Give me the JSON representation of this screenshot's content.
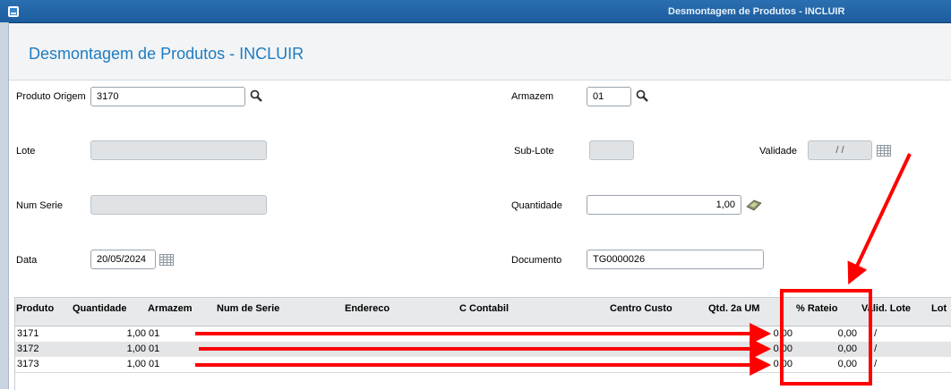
{
  "window": {
    "title": "Desmontagem de Produtos - INCLUIR"
  },
  "page": {
    "title": "Desmontagem de Produtos - INCLUIR"
  },
  "form": {
    "produto_origem": {
      "label": "Produto Origem",
      "value": "3170"
    },
    "armazem": {
      "label": "Armazem",
      "value": "01"
    },
    "lote": {
      "label": "Lote",
      "value": ""
    },
    "sub_lote": {
      "label": "Sub-Lote",
      "value": ""
    },
    "validade": {
      "label": "Validade",
      "value": "  /  /"
    },
    "num_serie": {
      "label": "Num Serie",
      "value": ""
    },
    "quantidade": {
      "label": "Quantidade",
      "value": "1,00"
    },
    "data": {
      "label": "Data",
      "value": "20/05/2024"
    },
    "documento": {
      "label": "Documento",
      "value": "TG0000026"
    }
  },
  "grid": {
    "columns": [
      "Produto",
      "Quantidade",
      "Armazem",
      "Num de Serie",
      "Endereco",
      "C Contabil",
      "Centro Custo",
      "Qtd. 2a UM",
      "% Rateio",
      "Valid. Lote",
      "Lot"
    ],
    "rows": [
      {
        "produto": "3171",
        "quantidade": "1,00",
        "armazem": "01",
        "qtd2": "0,00",
        "rateio": "0,00",
        "valid": "/ /"
      },
      {
        "produto": "3172",
        "quantidade": "1,00",
        "armazem": "01",
        "qtd2": "0,00",
        "rateio": "0,00",
        "valid": "/ /"
      },
      {
        "produto": "3173",
        "quantidade": "1,00",
        "armazem": "01",
        "qtd2": "0,00",
        "rateio": "0,00",
        "valid": "/ /"
      }
    ]
  },
  "icons": {
    "produto_lookup": "search-icon",
    "armazem_lookup": "search-icon",
    "validade_picker": "calendar-icon",
    "data_picker": "calendar-icon",
    "quantidade_calc": "calculator-icon",
    "window": "window-icon"
  },
  "colors": {
    "annotation": "#ff0000",
    "title": "#1e7cc0",
    "titlebar": "#1c5d9e"
  }
}
